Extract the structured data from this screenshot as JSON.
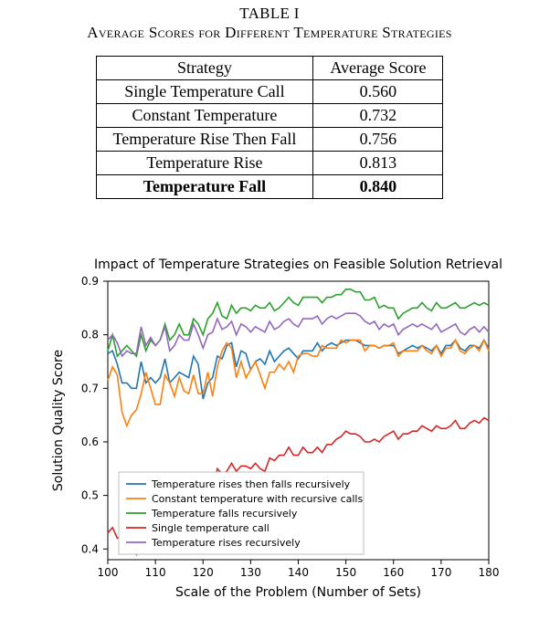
{
  "table": {
    "caption_line1": "TABLE I",
    "caption_line2": "Average Scores for Different Temperature Strategies",
    "headers": [
      "Strategy",
      "Average Score"
    ],
    "rows": [
      {
        "strategy": "Single Temperature Call",
        "score": "0.560",
        "bold": false
      },
      {
        "strategy": "Constant Temperature",
        "score": "0.732",
        "bold": false
      },
      {
        "strategy": "Temperature Rise Then Fall",
        "score": "0.756",
        "bold": false
      },
      {
        "strategy": "Temperature Rise",
        "score": "0.813",
        "bold": false
      },
      {
        "strategy": "Temperature Fall",
        "score": "0.840",
        "bold": true
      }
    ]
  },
  "chart_data": {
    "type": "line",
    "title": "Impact of Temperature Strategies on Feasible Solution Retrieval",
    "xlabel": "Scale of the Problem (Number of Sets)",
    "ylabel": "Solution Quality Score",
    "xlim": [
      100,
      180
    ],
    "ylim": [
      0.38,
      0.9
    ],
    "xticks": [
      100,
      110,
      120,
      130,
      140,
      150,
      160,
      170,
      180
    ],
    "yticks": [
      0.4,
      0.5,
      0.6,
      0.7,
      0.8,
      0.9
    ],
    "legend_position": "lower-center",
    "colors": {
      "rises_then_falls": "#1f77b4",
      "constant": "#ff7f0e",
      "falls": "#2ca02c",
      "single": "#d62728",
      "rises": "#9467bd"
    },
    "x": [
      100,
      101,
      102,
      103,
      104,
      105,
      106,
      107,
      108,
      109,
      110,
      111,
      112,
      113,
      114,
      115,
      116,
      117,
      118,
      119,
      120,
      121,
      122,
      123,
      124,
      125,
      126,
      127,
      128,
      129,
      130,
      131,
      132,
      133,
      134,
      135,
      136,
      137,
      138,
      139,
      140,
      141,
      142,
      143,
      144,
      145,
      146,
      147,
      148,
      149,
      150,
      151,
      152,
      153,
      154,
      155,
      156,
      157,
      158,
      159,
      160,
      161,
      162,
      163,
      164,
      165,
      166,
      167,
      168,
      169,
      170,
      171,
      172,
      173,
      174,
      175,
      176,
      177,
      178,
      179,
      180
    ],
    "series": [
      {
        "name": "Temperature rises then falls recursively",
        "color_key": "rises_then_falls",
        "values": [
          0.765,
          0.77,
          0.745,
          0.71,
          0.71,
          0.7,
          0.7,
          0.75,
          0.71,
          0.72,
          0.71,
          0.72,
          0.755,
          0.71,
          0.72,
          0.73,
          0.725,
          0.72,
          0.76,
          0.745,
          0.68,
          0.71,
          0.72,
          0.76,
          0.755,
          0.78,
          0.785,
          0.74,
          0.77,
          0.765,
          0.735,
          0.75,
          0.755,
          0.745,
          0.77,
          0.75,
          0.76,
          0.77,
          0.775,
          0.765,
          0.755,
          0.77,
          0.77,
          0.77,
          0.785,
          0.77,
          0.78,
          0.785,
          0.78,
          0.785,
          0.79,
          0.79,
          0.79,
          0.785,
          0.78,
          0.78,
          0.78,
          0.775,
          0.78,
          0.78,
          0.78,
          0.765,
          0.77,
          0.775,
          0.78,
          0.775,
          0.78,
          0.775,
          0.77,
          0.78,
          0.765,
          0.78,
          0.78,
          0.79,
          0.775,
          0.77,
          0.78,
          0.78,
          0.775,
          0.79,
          0.775
        ]
      },
      {
        "name": "Constant temperature with recursive calls",
        "color_key": "constant",
        "values": [
          0.715,
          0.74,
          0.725,
          0.655,
          0.63,
          0.65,
          0.66,
          0.69,
          0.73,
          0.7,
          0.67,
          0.67,
          0.725,
          0.71,
          0.685,
          0.72,
          0.695,
          0.69,
          0.725,
          0.69,
          0.69,
          0.73,
          0.685,
          0.74,
          0.77,
          0.785,
          0.775,
          0.72,
          0.75,
          0.72,
          0.735,
          0.75,
          0.725,
          0.7,
          0.73,
          0.73,
          0.745,
          0.735,
          0.75,
          0.73,
          0.76,
          0.765,
          0.765,
          0.76,
          0.76,
          0.78,
          0.775,
          0.775,
          0.775,
          0.79,
          0.785,
          0.79,
          0.79,
          0.79,
          0.77,
          0.78,
          0.78,
          0.775,
          0.78,
          0.78,
          0.785,
          0.76,
          0.77,
          0.77,
          0.77,
          0.77,
          0.78,
          0.77,
          0.765,
          0.78,
          0.76,
          0.775,
          0.775,
          0.79,
          0.77,
          0.765,
          0.775,
          0.78,
          0.77,
          0.79,
          0.77
        ]
      },
      {
        "name": "Temperature falls recursively",
        "color_key": "falls",
        "values": [
          0.77,
          0.8,
          0.76,
          0.77,
          0.78,
          0.77,
          0.76,
          0.8,
          0.77,
          0.79,
          0.78,
          0.79,
          0.82,
          0.79,
          0.8,
          0.82,
          0.8,
          0.8,
          0.83,
          0.82,
          0.8,
          0.83,
          0.84,
          0.86,
          0.835,
          0.83,
          0.855,
          0.84,
          0.85,
          0.85,
          0.845,
          0.855,
          0.85,
          0.85,
          0.86,
          0.845,
          0.85,
          0.86,
          0.87,
          0.86,
          0.855,
          0.87,
          0.87,
          0.87,
          0.87,
          0.86,
          0.87,
          0.87,
          0.875,
          0.875,
          0.885,
          0.885,
          0.88,
          0.88,
          0.865,
          0.865,
          0.87,
          0.85,
          0.855,
          0.85,
          0.85,
          0.83,
          0.84,
          0.845,
          0.85,
          0.85,
          0.86,
          0.85,
          0.845,
          0.86,
          0.85,
          0.85,
          0.855,
          0.86,
          0.85,
          0.85,
          0.855,
          0.86,
          0.855,
          0.86,
          0.855
        ]
      },
      {
        "name": "Single temperature call",
        "color_key": "single",
        "values": [
          0.43,
          0.44,
          0.42,
          0.425,
          0.43,
          0.41,
          0.39,
          0.41,
          0.42,
          0.43,
          0.45,
          0.45,
          0.48,
          0.465,
          0.47,
          0.49,
          0.48,
          0.485,
          0.5,
          0.49,
          0.49,
          0.51,
          0.51,
          0.55,
          0.54,
          0.545,
          0.56,
          0.545,
          0.555,
          0.555,
          0.55,
          0.56,
          0.55,
          0.545,
          0.57,
          0.565,
          0.575,
          0.575,
          0.59,
          0.575,
          0.575,
          0.59,
          0.58,
          0.58,
          0.59,
          0.58,
          0.595,
          0.595,
          0.605,
          0.61,
          0.62,
          0.615,
          0.615,
          0.61,
          0.6,
          0.6,
          0.605,
          0.6,
          0.61,
          0.615,
          0.62,
          0.605,
          0.615,
          0.615,
          0.62,
          0.62,
          0.63,
          0.625,
          0.62,
          0.63,
          0.625,
          0.625,
          0.63,
          0.64,
          0.625,
          0.625,
          0.635,
          0.64,
          0.635,
          0.645,
          0.64
        ]
      },
      {
        "name": "Temperature rises recursively",
        "color_key": "rises",
        "values": [
          0.79,
          0.8,
          0.785,
          0.76,
          0.77,
          0.765,
          0.765,
          0.815,
          0.78,
          0.795,
          0.78,
          0.79,
          0.815,
          0.77,
          0.78,
          0.8,
          0.79,
          0.79,
          0.82,
          0.8,
          0.775,
          0.8,
          0.805,
          0.83,
          0.81,
          0.815,
          0.825,
          0.8,
          0.82,
          0.815,
          0.805,
          0.815,
          0.81,
          0.805,
          0.825,
          0.81,
          0.815,
          0.825,
          0.83,
          0.82,
          0.815,
          0.83,
          0.83,
          0.83,
          0.835,
          0.82,
          0.83,
          0.835,
          0.83,
          0.835,
          0.84,
          0.84,
          0.84,
          0.835,
          0.825,
          0.82,
          0.825,
          0.81,
          0.82,
          0.815,
          0.82,
          0.8,
          0.81,
          0.815,
          0.82,
          0.815,
          0.82,
          0.815,
          0.81,
          0.82,
          0.805,
          0.81,
          0.815,
          0.82,
          0.805,
          0.8,
          0.81,
          0.815,
          0.805,
          0.815,
          0.805
        ]
      }
    ],
    "legend_labels": [
      "Temperature rises then falls recursively",
      "Constant temperature with recursive calls",
      "Temperature falls recursively",
      "Single temperature call",
      "Temperature rises recursively"
    ]
  }
}
